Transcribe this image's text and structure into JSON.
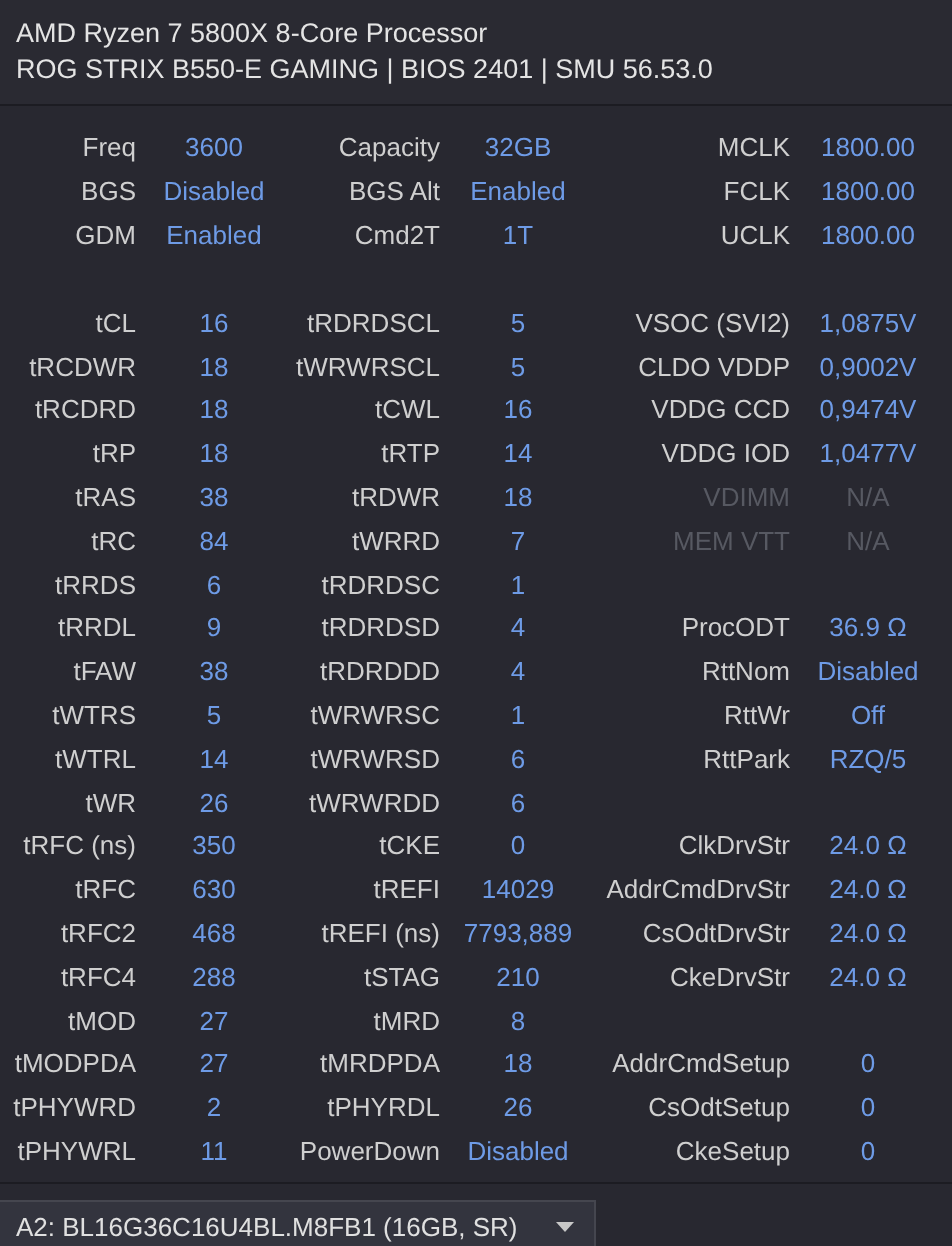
{
  "header": {
    "cpu": "AMD Ryzen 7 5800X 8-Core Processor",
    "board": "ROG STRIX B550-E GAMING | BIOS 2401 | SMU 56.53.0"
  },
  "summary": [
    {
      "left": {
        "label": "Freq",
        "value": "3600",
        "disabled": false
      },
      "middle": {
        "label": "Capacity",
        "value": "32GB",
        "disabled": false
      },
      "right": {
        "label": "MCLK",
        "value": "1800.00",
        "disabled": false
      }
    },
    {
      "left": {
        "label": "BGS",
        "value": "Disabled",
        "disabled": false
      },
      "middle": {
        "label": "BGS Alt",
        "value": "Enabled",
        "disabled": false
      },
      "right": {
        "label": "FCLK",
        "value": "1800.00",
        "disabled": false
      }
    },
    {
      "left": {
        "label": "GDM",
        "value": "Enabled",
        "disabled": false
      },
      "middle": {
        "label": "Cmd2T",
        "value": "1T",
        "disabled": false
      },
      "right": {
        "label": "UCLK",
        "value": "1800.00",
        "disabled": false
      }
    }
  ],
  "timings": [
    {
      "left": {
        "label": "tCL",
        "value": "16",
        "disabled": false
      },
      "middle": {
        "label": "tRDRDSCL",
        "value": "5",
        "disabled": false
      },
      "right": {
        "label": "VSOC (SVI2)",
        "value": "1,0875V",
        "disabled": false
      }
    },
    {
      "left": {
        "label": "tRCDWR",
        "value": "18",
        "disabled": false
      },
      "middle": {
        "label": "tWRWRSCL",
        "value": "5",
        "disabled": false
      },
      "right": {
        "label": "CLDO VDDP",
        "value": "0,9002V",
        "disabled": false
      }
    },
    {
      "left": {
        "label": "tRCDRD",
        "value": "18",
        "disabled": false
      },
      "middle": {
        "label": "tCWL",
        "value": "16",
        "disabled": false
      },
      "right": {
        "label": "VDDG CCD",
        "value": "0,9474V",
        "disabled": false
      }
    },
    {
      "left": {
        "label": "tRP",
        "value": "18",
        "disabled": false
      },
      "middle": {
        "label": "tRTP",
        "value": "14",
        "disabled": false
      },
      "right": {
        "label": "VDDG IOD",
        "value": "1,0477V",
        "disabled": false
      }
    },
    {
      "left": {
        "label": "tRAS",
        "value": "38",
        "disabled": false
      },
      "middle": {
        "label": "tRDWR",
        "value": "18",
        "disabled": false
      },
      "right": {
        "label": "VDIMM",
        "value": "N/A",
        "disabled": true
      }
    },
    {
      "left": {
        "label": "tRC",
        "value": "84",
        "disabled": false
      },
      "middle": {
        "label": "tWRRD",
        "value": "7",
        "disabled": false
      },
      "right": {
        "label": "MEM VTT",
        "value": "N/A",
        "disabled": true
      }
    },
    {
      "left": {
        "label": "tRRDS",
        "value": "6",
        "disabled": false
      },
      "middle": {
        "label": "tRDRDSC",
        "value": "1",
        "disabled": false
      }
    },
    {
      "left": {
        "label": "tRRDL",
        "value": "9",
        "disabled": false
      },
      "middle": {
        "label": "tRDRDSD",
        "value": "4",
        "disabled": false
      },
      "right": {
        "label": "ProcODT",
        "value": "36.9 Ω",
        "disabled": false
      }
    },
    {
      "left": {
        "label": "tFAW",
        "value": "38",
        "disabled": false
      },
      "middle": {
        "label": "tRDRDDD",
        "value": "4",
        "disabled": false
      },
      "right": {
        "label": "RttNom",
        "value": "Disabled",
        "disabled": false
      }
    },
    {
      "left": {
        "label": "tWTRS",
        "value": "5",
        "disabled": false
      },
      "middle": {
        "label": "tWRWRSC",
        "value": "1",
        "disabled": false
      },
      "right": {
        "label": "RttWr",
        "value": "Off",
        "disabled": false
      }
    },
    {
      "left": {
        "label": "tWTRL",
        "value": "14",
        "disabled": false
      },
      "middle": {
        "label": "tWRWRSD",
        "value": "6",
        "disabled": false
      },
      "right": {
        "label": "RttPark",
        "value": "RZQ/5",
        "disabled": false
      }
    },
    {
      "left": {
        "label": "tWR",
        "value": "26",
        "disabled": false
      },
      "middle": {
        "label": "tWRWRDD",
        "value": "6",
        "disabled": false
      }
    },
    {
      "left": {
        "label": "tRFC (ns)",
        "value": "350",
        "disabled": false
      },
      "middle": {
        "label": "tCKE",
        "value": "0",
        "disabled": false
      },
      "right": {
        "label": "ClkDrvStr",
        "value": "24.0 Ω",
        "disabled": false
      }
    },
    {
      "left": {
        "label": "tRFC",
        "value": "630",
        "disabled": false
      },
      "middle": {
        "label": "tREFI",
        "value": "14029",
        "disabled": false
      },
      "right": {
        "label": "AddrCmdDrvStr",
        "value": "24.0 Ω",
        "disabled": false
      }
    },
    {
      "left": {
        "label": "tRFC2",
        "value": "468",
        "disabled": false
      },
      "middle": {
        "label": "tREFI (ns)",
        "value": "7793,889",
        "disabled": false
      },
      "right": {
        "label": "CsOdtDrvStr",
        "value": "24.0 Ω",
        "disabled": false
      }
    },
    {
      "left": {
        "label": "tRFC4",
        "value": "288",
        "disabled": false
      },
      "middle": {
        "label": "tSTAG",
        "value": "210",
        "disabled": false
      },
      "right": {
        "label": "CkeDrvStr",
        "value": "24.0 Ω",
        "disabled": false
      }
    },
    {
      "left": {
        "label": "tMOD",
        "value": "27",
        "disabled": false
      },
      "middle": {
        "label": "tMRD",
        "value": "8",
        "disabled": false
      }
    },
    {
      "left": {
        "label": "tMODPDA",
        "value": "27",
        "disabled": false
      },
      "middle": {
        "label": "tMRDPDA",
        "value": "18",
        "disabled": false
      },
      "right": {
        "label": "AddrCmdSetup",
        "value": "0",
        "disabled": false
      }
    },
    {
      "left": {
        "label": "tPHYWRD",
        "value": "2",
        "disabled": false
      },
      "middle": {
        "label": "tPHYRDL",
        "value": "26",
        "disabled": false
      },
      "right": {
        "label": "CsOdtSetup",
        "value": "0",
        "disabled": false
      }
    },
    {
      "left": {
        "label": "tPHYWRL",
        "value": "11",
        "disabled": false
      },
      "middle": {
        "label": "PowerDown",
        "value": "Disabled",
        "disabled": false
      },
      "right": {
        "label": "CkeSetup",
        "value": "0",
        "disabled": false
      }
    }
  ],
  "module_select": {
    "value": "A2: BL16G36C16U4BL.M8FB1 (16GB, SR)"
  }
}
